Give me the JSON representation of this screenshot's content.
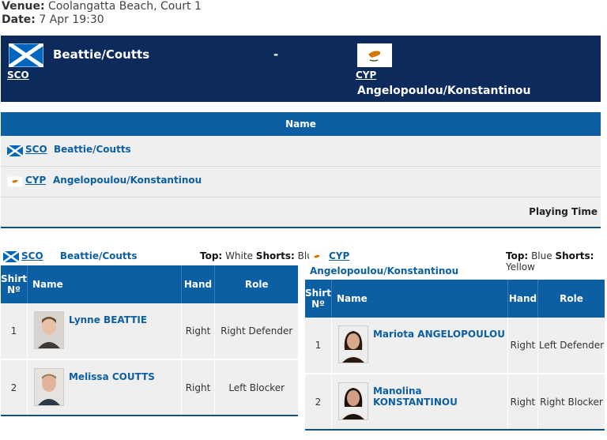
{
  "venue": {
    "venue_label": "Venue:",
    "venue_value": "Coolangatta Beach, Court 1",
    "date_label": "Date:",
    "date_value": "7 Apr 19:30"
  },
  "header": {
    "team1": {
      "name": "Beattie/Coutts",
      "code": "SCO"
    },
    "separator": "-",
    "team2": {
      "name": "Angelopoulou/Konstantinou",
      "code": "CYP"
    }
  },
  "summary": {
    "column_header": "Name",
    "rows": [
      {
        "code": "SCO",
        "team": "Beattie/Coutts"
      },
      {
        "code": "CYP",
        "team": "Angelopoulou/Konstantinou"
      }
    ],
    "footer": "Playing Time"
  },
  "rosters": [
    {
      "code": "SCO",
      "team": "Beattie/Coutts",
      "top_label": "Top:",
      "top_value": "White",
      "shorts_label": "Shorts:",
      "shorts_value": "Blue",
      "columns": [
        "Shirt Nº",
        "Name",
        "Hand",
        "Role"
      ],
      "players": [
        {
          "shirt": "1",
          "name": "Lynne BEATTIE",
          "hand": "Right",
          "role": "Right Defender"
        },
        {
          "shirt": "2",
          "name": "Melissa COUTTS",
          "hand": "Right",
          "role": "Left Blocker"
        }
      ]
    },
    {
      "code": "CYP",
      "team": "Angelopoulou/Konstantinou",
      "top_label": "Top:",
      "top_value": "Blue",
      "shorts_label": "Shorts:",
      "shorts_value": "Yellow",
      "columns": [
        "Shirt Nº",
        "Name",
        "Hand",
        "Role"
      ],
      "players": [
        {
          "shirt": "1",
          "name": "Mariota ANGELOPOULOU",
          "hand": "Right",
          "role": "Left Defender"
        },
        {
          "shirt": "2",
          "name": "Manolina KONSTANTINOU",
          "hand": "Right",
          "role": "Right Blocker"
        }
      ]
    }
  ],
  "colors": {
    "header_bg": "#0c2a5c",
    "accent": "#0d5fa3",
    "row_bg": "#efefef"
  }
}
